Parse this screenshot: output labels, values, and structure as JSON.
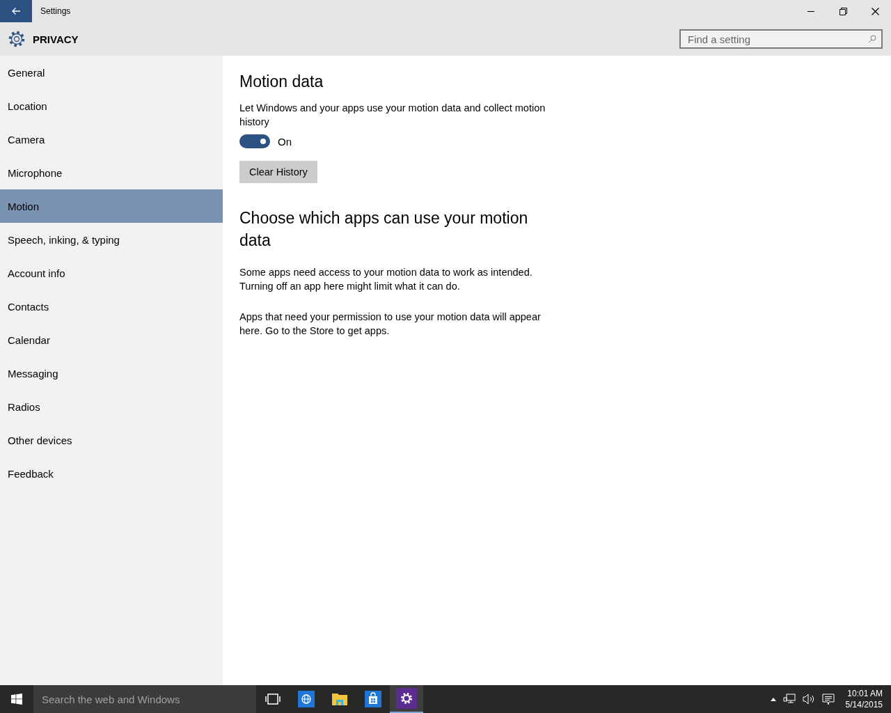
{
  "window": {
    "title": "Settings"
  },
  "header": {
    "title": "PRIVACY",
    "search": {
      "placeholder": "Find a setting"
    }
  },
  "sidebar": {
    "items": [
      {
        "label": "General",
        "selected": false
      },
      {
        "label": "Location",
        "selected": false
      },
      {
        "label": "Camera",
        "selected": false
      },
      {
        "label": "Microphone",
        "selected": false
      },
      {
        "label": "Motion",
        "selected": true
      },
      {
        "label": "Speech, inking, & typing",
        "selected": false
      },
      {
        "label": "Account info",
        "selected": false
      },
      {
        "label": "Contacts",
        "selected": false
      },
      {
        "label": "Calendar",
        "selected": false
      },
      {
        "label": "Messaging",
        "selected": false
      },
      {
        "label": "Radios",
        "selected": false
      },
      {
        "label": "Other devices",
        "selected": false
      },
      {
        "label": "Feedback",
        "selected": false
      }
    ]
  },
  "content": {
    "heading": "Motion data",
    "description": "Let Windows and your apps use your motion data and collect motion history",
    "toggle": {
      "on": true,
      "label": "On"
    },
    "clear_button": "Clear History",
    "apps_heading": "Choose which apps can use your motion data",
    "paragraphs": [
      "Some apps need access to your motion data to work as intended. Turning off an app here might limit what it can do.",
      "Apps that need your permission to use your motion data will appear here. Go to the Store to get apps."
    ]
  },
  "taskbar": {
    "search": {
      "placeholder": "Search the web and Windows"
    },
    "apps": [
      {
        "kind": "task-view",
        "selected": false
      },
      {
        "kind": "browser",
        "selected": false
      },
      {
        "kind": "folder",
        "selected": false
      },
      {
        "kind": "store",
        "selected": false
      },
      {
        "kind": "settings",
        "selected": true
      }
    ],
    "time": "10:01 AM",
    "date": "5/14/2015"
  }
}
